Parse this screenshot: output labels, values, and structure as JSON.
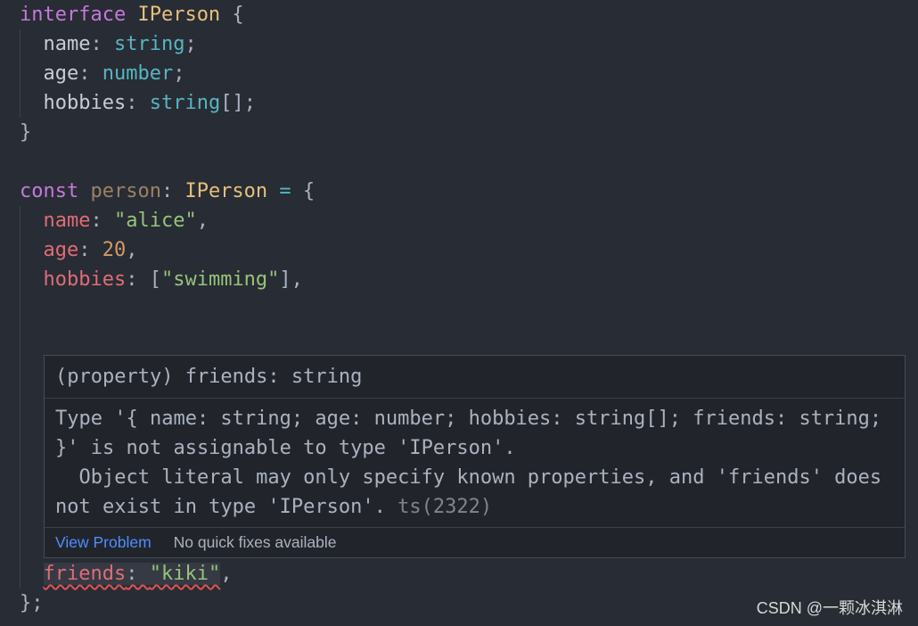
{
  "theme": {
    "editor_background": "#282c34",
    "foreground": "#abb2bf",
    "keyword": "#c678dd",
    "type": "#e5c07b",
    "primitive": "#56b6c2",
    "operator": "#56b6c2",
    "property": "#e06c75",
    "member": "#c8ccd4",
    "string": "#98c379",
    "number": "#d19a66",
    "unused": "#9b8264",
    "error": "#e05252",
    "link": "#528bff",
    "hover_background": "#21252b",
    "muted": "#7f848e"
  },
  "code_lines": [
    [
      "interface",
      " IPerson",
      " {"
    ],
    [
      "name",
      ": ",
      "string",
      ";"
    ],
    [
      "age",
      ": ",
      "number",
      ";"
    ],
    [
      "hobbies",
      ": ",
      "string",
      "[];"
    ],
    [
      "}"
    ],
    [],
    [
      "const",
      " person",
      ":",
      " IPerson",
      " =",
      " {"
    ],
    [
      "name",
      ": ",
      "\"alice\"",
      ","
    ],
    [
      "age",
      ": ",
      "20",
      ","
    ],
    [
      "hobbies",
      ": [",
      "\"swimming\"",
      "],"
    ],
    [],
    [],
    [],
    [],
    [],
    [],
    [],
    [],
    [],
    [
      "friends",
      ": ",
      "\"kiki\"",
      ","
    ],
    [
      "};"
    ]
  ],
  "hover": {
    "signature": "(property) friends: string",
    "message_lines": [
      "Type '{ name: string; age: number; hobbies: string[]; friends: string;",
      "}' is not assignable to type 'IPerson'.",
      "  Object literal may only specify known properties, and 'friends' does",
      "not exist in type 'IPerson'."
    ],
    "error_code": "ts(2322)",
    "view_problem_label": "View Problem",
    "quick_fix_status": "No quick fixes available"
  },
  "watermark": "CSDN @一颗冰淇淋"
}
